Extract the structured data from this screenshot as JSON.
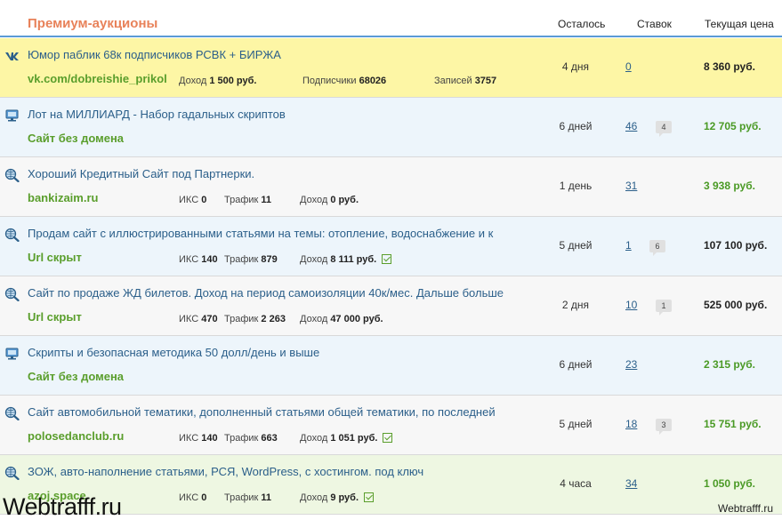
{
  "header": {
    "title": "Премиум-аукционы",
    "col_left": "Осталось",
    "col_bids": "Ставок",
    "col_price": "Текущая цена"
  },
  "rows": [
    {
      "icon": "vk-icon",
      "title": "Юмор паблик 68к подписчиков РСВК + БИРЖА",
      "sub": "vk.com/dobreishie_prikol",
      "m1_label": "Доход",
      "m1_value": "1 500 руб.",
      "m2_label": "Подписчики",
      "m2_value": "68026",
      "m3_label": "Записей",
      "m3_value": "3757",
      "left": "4 дня",
      "bids": "0",
      "comments": "",
      "price": "8 360 руб."
    },
    {
      "icon": "monitor-icon",
      "title": "Лот на МИЛЛИАРД - Набор гадальных скриптов",
      "sub": "Сайт без домена",
      "left": "6 дней",
      "bids": "46",
      "comments": "4",
      "price": "12 705 руб."
    },
    {
      "icon": "globe-search-icon",
      "title": "Хороший Кредитный Сайт под Партнерки.",
      "sub": "bankizaim.ru",
      "m1_label": "ИКС",
      "m1_value": "0",
      "m2_label": "Трафик",
      "m2_value": "11",
      "m3_label": "Доход",
      "m3_value": "0 руб.",
      "left": "1 день",
      "bids": "31",
      "comments": "",
      "price": "3 938 руб."
    },
    {
      "icon": "globe-search-icon",
      "title": "Продам сайт с иллюстрированными статьями на темы: отопление, водоснабжение и к",
      "sub": "Url скрыт",
      "m1_label": "ИКС",
      "m1_value": "140",
      "m2_label": "Трафик",
      "m2_value": "879",
      "m3_label": "Доход",
      "m3_value": "8 111 руб.",
      "verified": true,
      "left": "5 дней",
      "bids": "1",
      "comments": "6",
      "price": "107 100 руб."
    },
    {
      "icon": "globe-search-icon",
      "title": "Сайт по продаже ЖД билетов. Доход на период самоизоляции 40к/мес. Дальше больше",
      "sub": "Url скрыт",
      "m1_label": "ИКС",
      "m1_value": "470",
      "m2_label": "Трафик",
      "m2_value": "2 263",
      "m3_label": "Доход",
      "m3_value": "47 000 руб.",
      "left": "2 дня",
      "bids": "10",
      "comments": "1",
      "price": "525 000 руб."
    },
    {
      "icon": "monitor-icon",
      "title": "Скрипты и безопасная методика 50 долл/день и выше",
      "sub": "Сайт без домена",
      "left": "6 дней",
      "bids": "23",
      "comments": "",
      "price": "2 315 руб."
    },
    {
      "icon": "globe-search-icon",
      "title": "Сайт автомобильной тематики, дополненный статьями общей тематики, по последней",
      "sub": "polosedanclub.ru",
      "m1_label": "ИКС",
      "m1_value": "140",
      "m2_label": "Трафик",
      "m2_value": "663",
      "m3_label": "Доход",
      "m3_value": "1 051 руб.",
      "verified": true,
      "left": "5 дней",
      "bids": "18",
      "comments": "3",
      "price": "15 751 руб."
    },
    {
      "icon": "globe-search-icon",
      "title": "ЗОЖ, авто-наполнение статьями, РСЯ, WordPress, с хостингом. под ключ",
      "sub": "azoj.space",
      "m1_label": "ИКС",
      "m1_value": "0",
      "m2_label": "Трафик",
      "m2_value": "11",
      "m3_label": "Доход",
      "m3_value": "9 руб.",
      "verified": true,
      "left": "4 часа",
      "bids": "34",
      "comments": "",
      "price": "1 050 руб."
    }
  ],
  "watermark_left": "Webtrafff.ru",
  "watermark_right": "Webtrafff.ru",
  "colors": {
    "accent_title": "#e8825a",
    "link": "#2b5f8a",
    "green": "#5a9e2c",
    "premium_bg": "#fdf6a5"
  }
}
